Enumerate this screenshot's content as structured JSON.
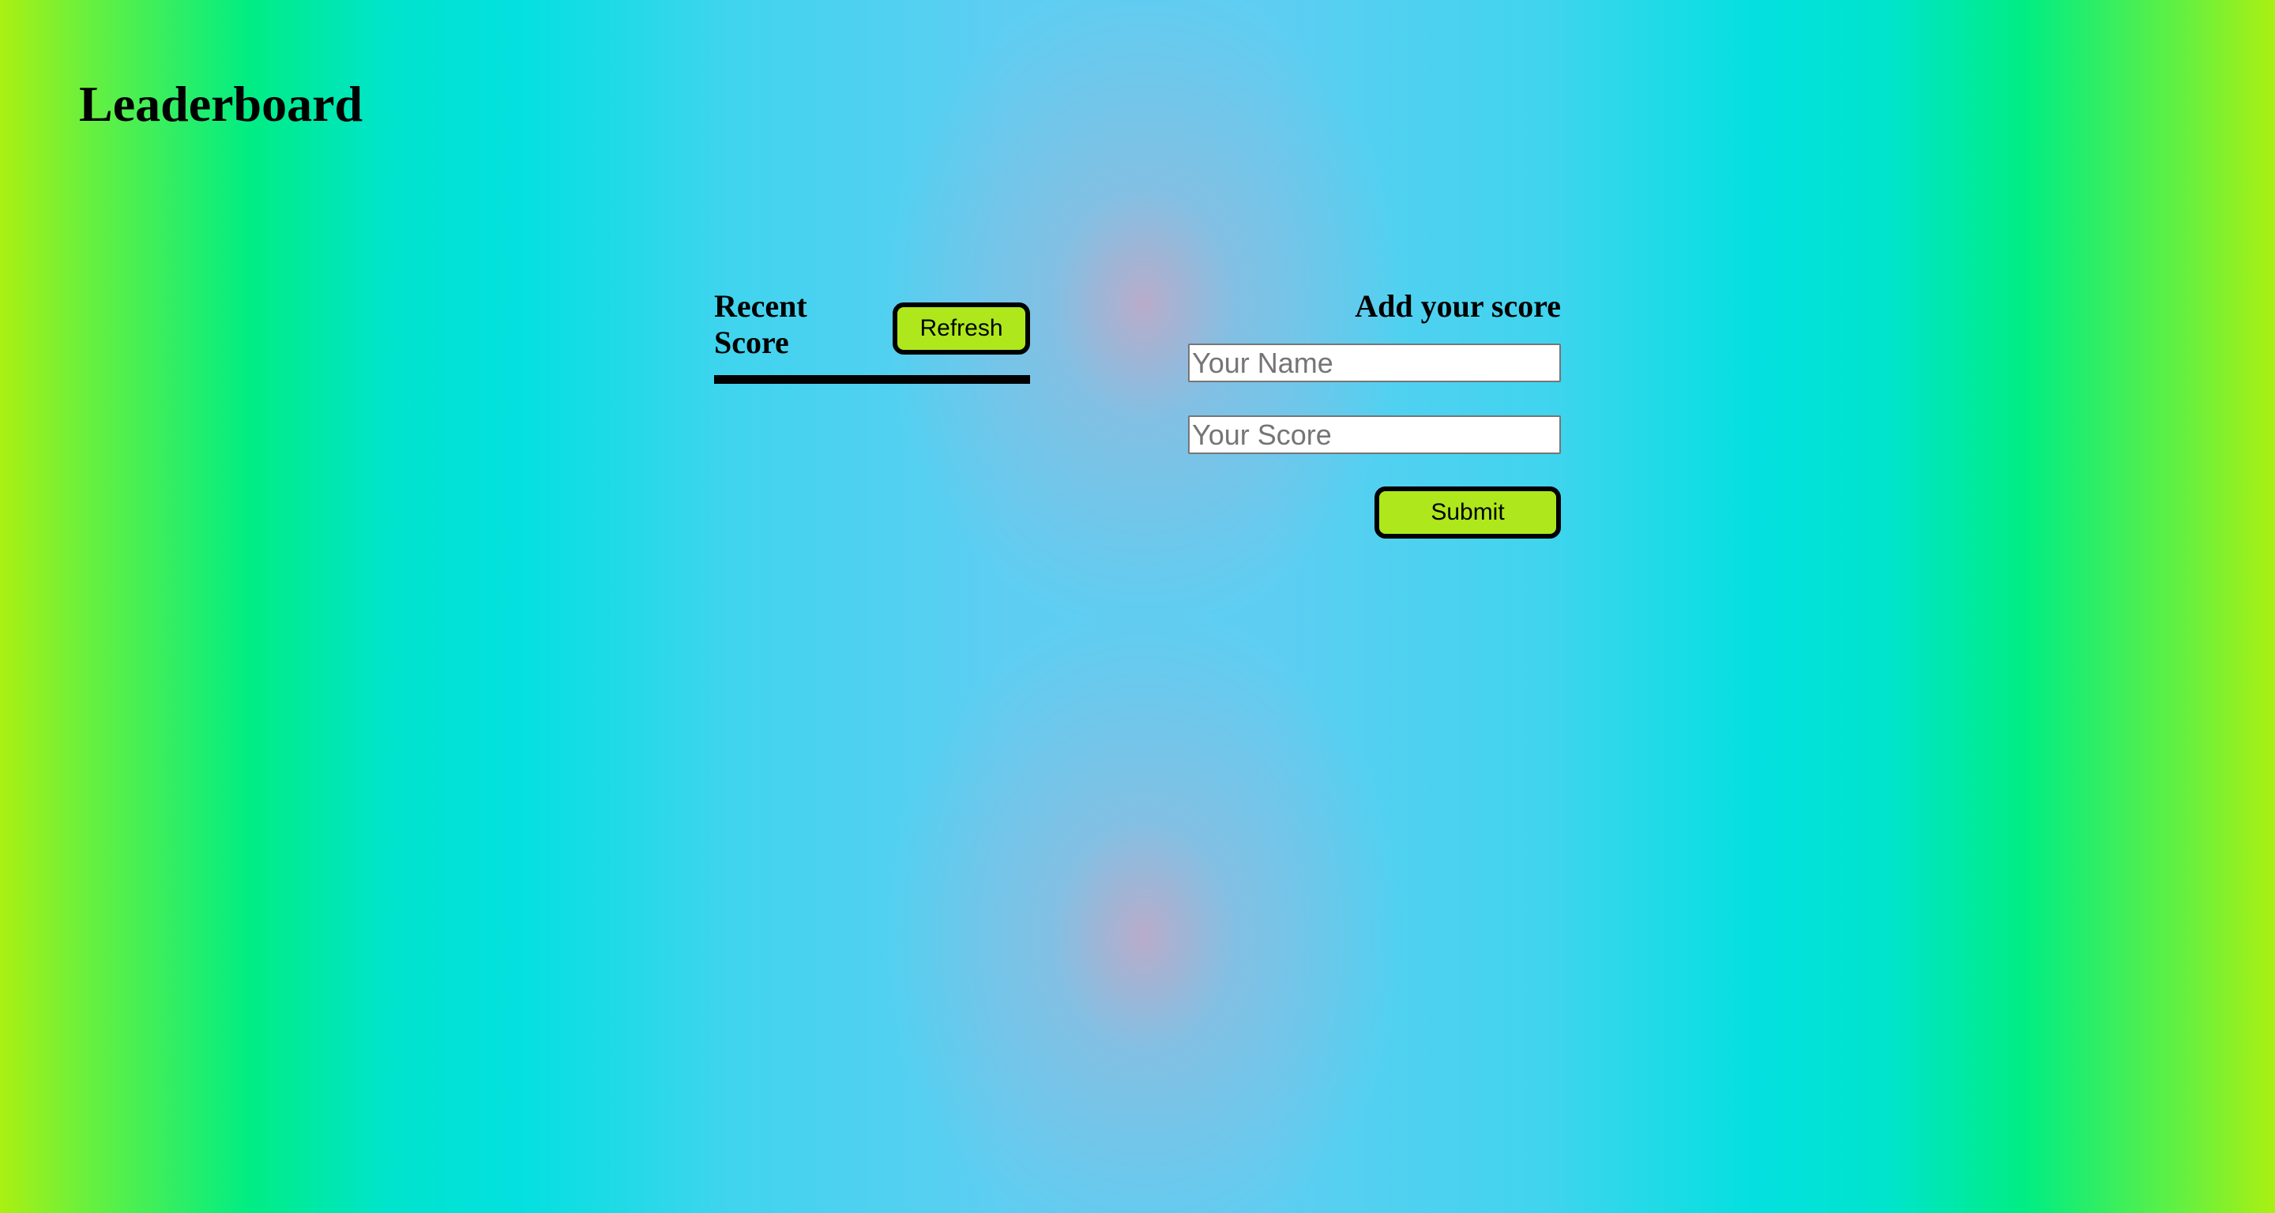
{
  "page": {
    "title": "Leaderboard"
  },
  "recent_scores": {
    "title": "Recent Score",
    "refresh_label": "Refresh",
    "items": []
  },
  "add_score": {
    "title": "Add your score",
    "name_placeholder": "Your Name",
    "name_value": "",
    "score_placeholder": "Your Score",
    "score_value": "",
    "submit_label": "Submit"
  },
  "colors": {
    "button_background": "#aee81c",
    "button_border": "#000000",
    "background_edge": "#aaf012",
    "background_green": "#00ed84",
    "background_cyan": "#04e0e0",
    "background_sky": "#5dcef2",
    "background_glow": "#bcaac8"
  }
}
